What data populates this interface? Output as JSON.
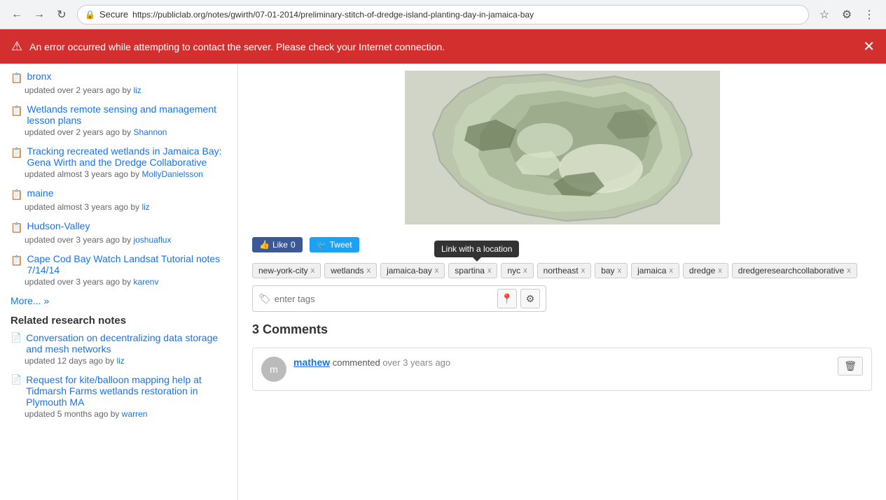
{
  "browser": {
    "url": "https://publiclab.org/notes/gwirth/07-01-2014/preliminary-stitch-of-dredge-island-planting-day-in-jamaica-bay",
    "secure_label": "Secure"
  },
  "error_banner": {
    "message": "An error occurred while attempting to contact the server. Please check your Internet connection."
  },
  "sidebar": {
    "items": [
      {
        "icon": "book",
        "title": "bronx",
        "meta": "updated over 2 years ago by",
        "author": "liz",
        "type": "wiki"
      },
      {
        "icon": "book",
        "title": "Wetlands remote sensing and management lesson plans",
        "meta": "updated over 2 years ago by",
        "author": "Shannon",
        "type": "wiki"
      },
      {
        "icon": "book",
        "title": "Tracking recreated wetlands in Jamaica Bay: Gena Wirth and the Dredge Collaborative",
        "meta": "updated almost 3 years ago by",
        "author": "MollyDanielsson",
        "type": "wiki"
      },
      {
        "icon": "book",
        "title": "maine",
        "meta": "updated almost 3 years ago by",
        "author": "liz",
        "type": "wiki"
      },
      {
        "icon": "book",
        "title": "Hudson-Valley",
        "meta": "updated over 3 years ago by",
        "author": "joshuaflux",
        "type": "wiki"
      },
      {
        "icon": "book",
        "title": "Cape Cod Bay Watch Landsat Tutorial notes 7/14/14",
        "meta": "updated over 3 years ago by",
        "author": "karenv",
        "type": "wiki"
      }
    ],
    "more_label": "More... »",
    "related_header": "Related research notes",
    "related_items": [
      {
        "icon": "file",
        "title": "Conversation on decentralizing data storage and mesh networks",
        "meta": "updated 12 days ago by",
        "author": "liz",
        "type": "note"
      },
      {
        "icon": "file",
        "title": "Request for kite/balloon mapping help at Tidmarsh Farms wetlands restoration in Plymouth MA",
        "meta": "updated 5 months ago by",
        "author": "warren",
        "type": "note"
      }
    ]
  },
  "tags": [
    "new-york-city",
    "wetlands",
    "jamaica-bay",
    "spartina",
    "nyc",
    "northeast",
    "bay",
    "jamaica",
    "dredge",
    "dredgeresearchcollaborative"
  ],
  "tooltip": {
    "text": "Link with a location"
  },
  "tag_input": {
    "placeholder": "enter tags"
  },
  "social": {
    "like_label": "Like",
    "like_count": "0",
    "tweet_label": "Tweet"
  },
  "comments": {
    "header": "3 Comments",
    "items": [
      {
        "username": "mathew",
        "action": "commented",
        "timestamp": "over 3 years ago",
        "avatar_initial": "m"
      }
    ]
  }
}
